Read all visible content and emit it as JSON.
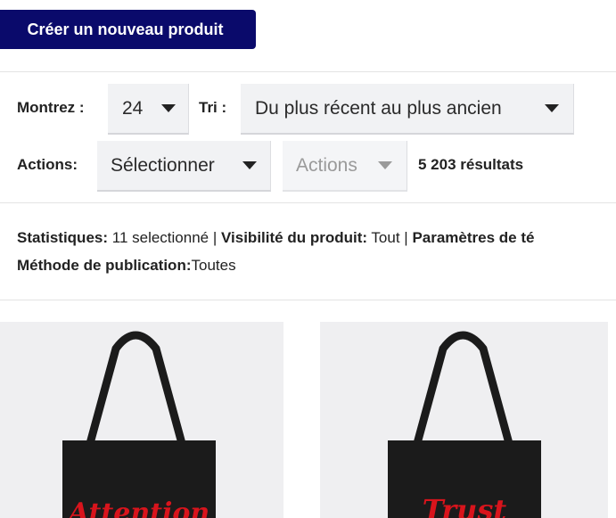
{
  "toolbar": {
    "create_label": "Créer un nouveau produit"
  },
  "filters": {
    "show_label": "Montrez :",
    "show_value": "24",
    "sort_label": "Tri :",
    "sort_value": "Du plus récent au plus ancien",
    "actions_label": "Actions:",
    "select_value": "Sélectionner",
    "actions_value": "Actions",
    "results": "5 203 résultats"
  },
  "stats": {
    "stats_label": "Statistiques:",
    "stats_value": " 11 selectionné | ",
    "visibility_label": "Visibilité du produit:",
    "visibility_value": " Tout | ",
    "params_label": "Paramètres de té",
    "publication_label": "Méthode de publication:",
    "publication_value": "Toutes"
  },
  "products": [
    {
      "bag_text": "Attention",
      "bag_color": "#1b1b1b",
      "text_color": "#d8141c"
    },
    {
      "bag_text": "Trust",
      "bag_color": "#1b1b1b",
      "text_color": "#d8141c"
    }
  ],
  "colors": {
    "primary": "#0a0a6b",
    "divider": "#e3e3e3",
    "dropdown_bg": "#f1f2f4"
  }
}
